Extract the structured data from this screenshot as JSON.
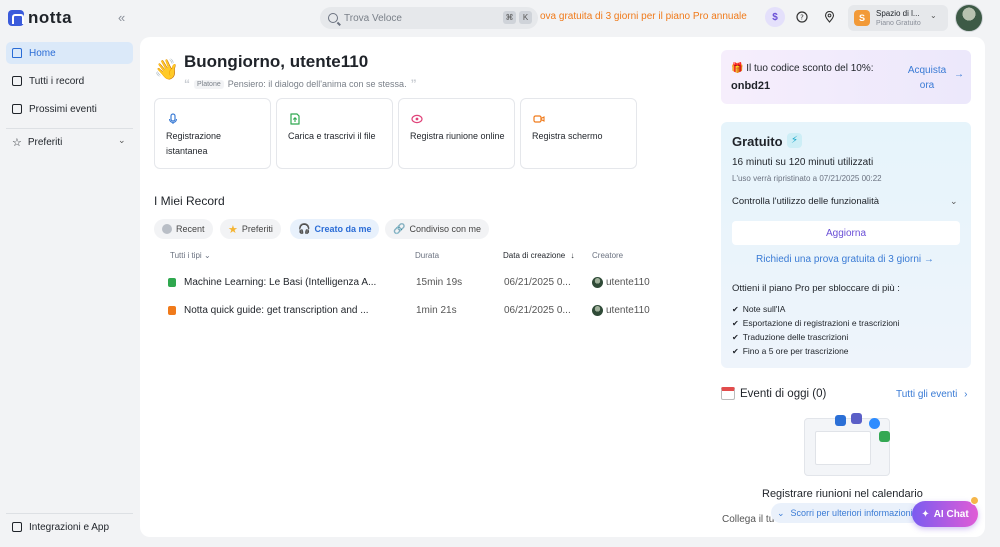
{
  "app": {
    "name": "notta"
  },
  "topbar": {
    "search_placeholder": "Trova Veloce",
    "kbd_1": "⌘",
    "kbd_2": "K",
    "promo": "ova gratuita di 3 giorni per il piano Pro annuale",
    "workspace_name": "Spazio di l...",
    "workspace_plan": "Piano Gratuito",
    "workspace_initial": "S",
    "icons": [
      "collapse-sidebar-icon",
      "upgrade-coin-icon",
      "help-icon",
      "location-pin-icon",
      "chevron-down-icon"
    ]
  },
  "sidebar": {
    "items": [
      {
        "label": "Home",
        "icon": "home-icon",
        "active": true
      },
      {
        "label": "Tutti i record",
        "icon": "folder-icon",
        "active": false
      },
      {
        "label": "Prossimi eventi",
        "icon": "calendar-icon",
        "active": false
      },
      {
        "label": "Preferiti",
        "icon": "star-icon",
        "active": false
      }
    ],
    "bottom_item": {
      "label": "Integrazioni e App",
      "icon": "apps-icon"
    }
  },
  "greeting": {
    "emoji": "👋",
    "title": "Buongiorno, utente110",
    "quote_author": "Platone",
    "quote_text": "Pensiero: il dialogo dell'anima con se stessa."
  },
  "actions": [
    {
      "label": "Registrazione istantanea",
      "icon": "microphone-icon",
      "color": "#3a7bd5"
    },
    {
      "label": "Carica e trascrivi il file",
      "icon": "upload-file-icon",
      "color": "#2fa84f"
    },
    {
      "label": "Registra riunione online",
      "icon": "meeting-icon",
      "color": "#e0447a"
    },
    {
      "label": "Registra schermo",
      "icon": "screen-record-icon",
      "color": "#f07a1a"
    }
  ],
  "records": {
    "title": "I Miei Record",
    "chips": [
      {
        "label": "Recent",
        "icon": "clock-icon",
        "active": false
      },
      {
        "label": "Preferiti",
        "icon": "star-icon",
        "active": false
      },
      {
        "label": "Creato da me",
        "icon": "headphones-icon",
        "active": true
      },
      {
        "label": "Condiviso con me",
        "icon": "link-icon",
        "active": false
      }
    ],
    "columns": {
      "type": "Tutti i tipi",
      "duration": "Durata",
      "created": "Data di creazione",
      "creator": "Creatore"
    },
    "rows": [
      {
        "name": "Machine Learning: Le Basi (Intelligenza A...",
        "duration": "15min 19s",
        "date": "06/21/2025 0...",
        "creator": "utente110",
        "icon_color": "#2fa84f"
      },
      {
        "name": "Notta quick guide: get transcription and ...",
        "duration": "1min 21s",
        "date": "06/21/2025 0...",
        "creator": "utente110",
        "icon_color": "#f07a1a"
      }
    ]
  },
  "coupon": {
    "text": "Il tuo codice sconto del 10%:",
    "code": "onbd21",
    "cta": "Acquista ora",
    "icon": "gift-icon"
  },
  "plan": {
    "title": "Gratuito",
    "usage": "16 minuti su 120 minuti utilizzati",
    "reset": "L'uso verrà ripristinato a 07/21/2025 00:22",
    "control": "Controlla l'utilizzo delle funzionalità",
    "upgrade": "Aggiorna",
    "trial": "Richiedi una prova gratuita di 3 giorni →",
    "get_pro": "Ottieni il piano Pro per sbloccare di più :",
    "features": [
      "Note sull'IA",
      "Esportazione di registrazioni e trascrizioni",
      "Traduzione delle trascrizioni",
      "Fino a 5 ore per trascrizione"
    ]
  },
  "events": {
    "title": "Eventi di oggi (0)",
    "all_link": "Tutti gli eventi",
    "heading": "Registrare riunioni nel calendario",
    "sub": "Collega il tu"
  },
  "floating": {
    "scroll_hint": "Scorri per ulteriori informazioni",
    "ai_chat": "AI Chat"
  }
}
